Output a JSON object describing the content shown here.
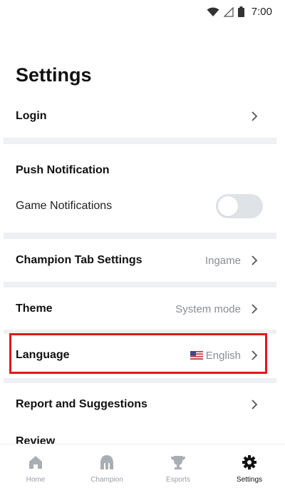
{
  "status": {
    "time": "7:00",
    "icons": [
      "wifi-icon",
      "signal-icon",
      "battery-icon"
    ]
  },
  "page": {
    "title": "Settings"
  },
  "rows": {
    "login": {
      "label": "Login"
    },
    "push": {
      "header": "Push Notification",
      "game_notifications": "Game Notifications",
      "game_notifications_on": false
    },
    "champion_tab": {
      "label": "Champion Tab Settings",
      "value": "Ingame"
    },
    "theme": {
      "label": "Theme",
      "value": "System mode"
    },
    "language": {
      "label": "Language",
      "value": "English",
      "flag": "us-flag-icon"
    },
    "report": {
      "label": "Report and Suggestions"
    },
    "review": {
      "label": "Review"
    }
  },
  "nav": {
    "items": [
      {
        "label": "Home",
        "icon": "home-icon"
      },
      {
        "label": "Champion",
        "icon": "champion-icon"
      },
      {
        "label": "Esports",
        "icon": "trophy-icon"
      },
      {
        "label": "Settings",
        "icon": "gear-icon",
        "active": true
      }
    ]
  },
  "colors": {
    "highlight": "#e01818",
    "divider": "#eef0f3",
    "muted": "#8a8d92"
  }
}
